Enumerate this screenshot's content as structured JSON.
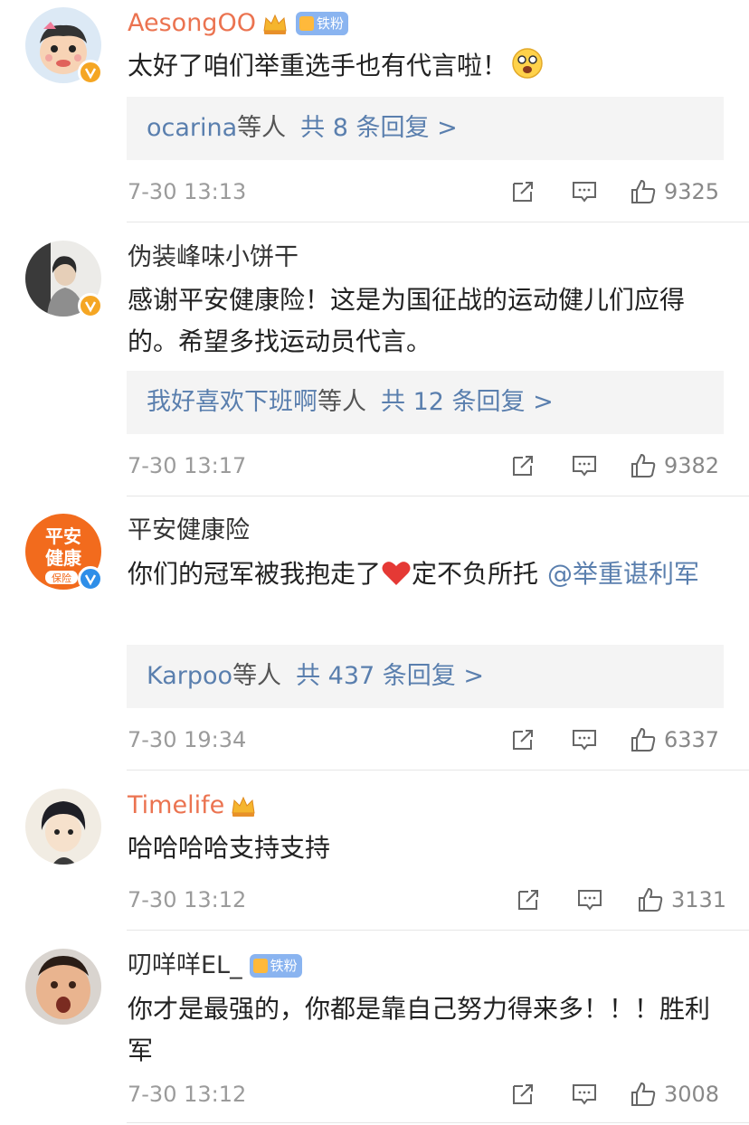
{
  "colors": {
    "orange_name": "#eb7350",
    "link_blue": "#5a7fae",
    "verify_badge_gold": "#f5a623",
    "verify_badge_blue": "#2e8ee8",
    "reply_box_bg": "#f4f4f4",
    "meta_gray": "#9b9b9b"
  },
  "comments": [
    {
      "user": "AesongOO",
      "badge_text": "铁粉",
      "text": "太好了咱们举重选手也有代言啦！",
      "reply_who": "ocarina",
      "reply_etc": "等人",
      "reply_count": "共 8 条回复 >",
      "time": "7-30 13:13",
      "likes": "9325"
    },
    {
      "user": "伪装峰味小饼干",
      "text": "感谢平安健康险！这是为国征战的运动健儿们应得的。希望多找运动员代言。",
      "reply_who": "我好喜欢下班啊",
      "reply_etc": "等人",
      "reply_count": "共 12 条回复 >",
      "time": "7-30 13:17",
      "likes": "9382"
    },
    {
      "user": "平安健康险",
      "avatar_text_1": "平安",
      "avatar_text_2": "健康",
      "avatar_text_3": "保险",
      "text_a": "你们的冠军被我抱走了",
      "text_b": "定不负所托",
      "mention": "@举重谌利军",
      "reply_who": "Karpoo",
      "reply_etc": "等人",
      "reply_count": "共 437 条回复 >",
      "time": "7-30 19:34",
      "likes": "6337"
    },
    {
      "user": "Timelife",
      "text": "哈哈哈哈支持支持",
      "time": "7-30 13:12",
      "likes": "3131"
    },
    {
      "user": "叨咩咩EL_",
      "badge_text": "铁粉",
      "text": "你才是最强的，你都是靠自己努力得来多！！！胜利军",
      "time": "7-30 13:12",
      "likes": "3008"
    }
  ]
}
